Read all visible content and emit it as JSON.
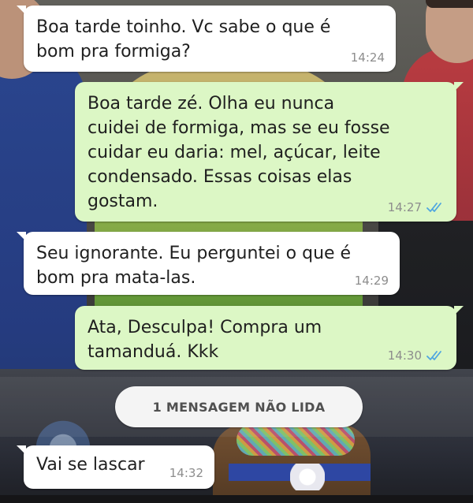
{
  "chat": {
    "messages": [
      {
        "direction": "incoming",
        "text": "Boa tarde toinho. Vc sabe o que é\nbom pra formiga?",
        "time": "14:24"
      },
      {
        "direction": "outgoing",
        "text": "Boa tarde zé.  Olha eu nunca\ncuidei de formiga, mas se eu fosse\ncuidar eu daria: mel, açúcar, leite\ncondensado. Essas coisas elas\ngostam.",
        "time": "14:27",
        "status_icon": "double-check-icon",
        "status_color": "#4fa6e0"
      },
      {
        "direction": "incoming",
        "text": "Seu ignorante. Eu perguntei o que é\nbom pra mata-las.",
        "time": "14:29"
      },
      {
        "direction": "outgoing",
        "text": "Ata, Desculpa! Compra um\ntamanduá. Kkk",
        "time": "14:30",
        "status_icon": "double-check-icon",
        "status_color": "#4fa6e0"
      },
      {
        "direction": "incoming",
        "text": "Vai se lascar",
        "time": "14:32"
      }
    ],
    "unread_label": "1 MENSAGEM NÃO LIDA"
  },
  "colors": {
    "incoming_bubble": "#ffffff",
    "outgoing_bubble": "#dcf7c5",
    "read_tick": "#4fa6e0",
    "timestamp": "#8d8d8d"
  }
}
